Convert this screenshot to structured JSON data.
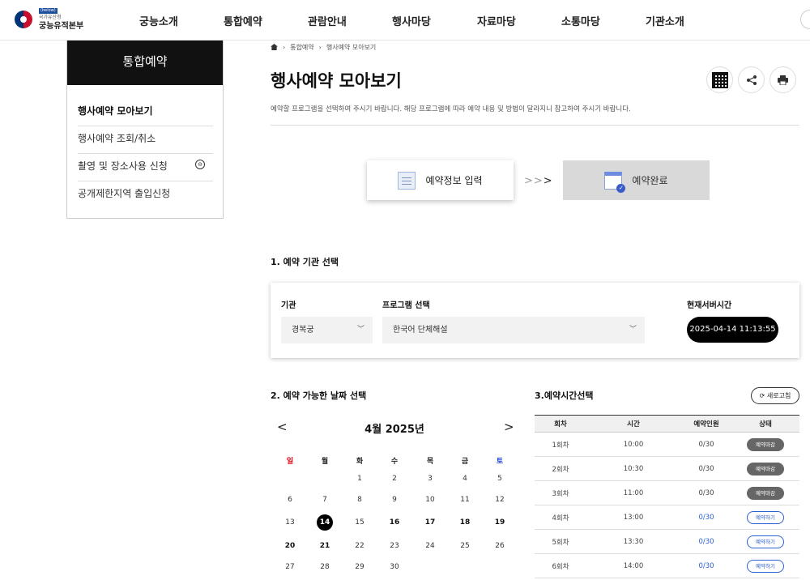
{
  "header": {
    "logo": {
      "tag": "(below)",
      "sub": "국가유산청",
      "name": "궁능유적본부"
    },
    "nav": [
      "궁능소개",
      "통합예약",
      "관람안내",
      "행사마당",
      "자료마당",
      "소통마당",
      "기관소개"
    ]
  },
  "sidebar": {
    "title": "통합예약",
    "items": [
      {
        "label": "행사예약 모아보기",
        "active": true
      },
      {
        "label": "행사예약 조회/취소",
        "active": false
      },
      {
        "label": "촬영 및 장소사용 신청",
        "active": false,
        "toggle": "⊖"
      },
      {
        "label": "공개제한지역 출입신청",
        "active": false
      }
    ]
  },
  "breadcrumb": {
    "level1": "통합예약",
    "level2": "행사예약 모아보기"
  },
  "page": {
    "title": "행사예약 모아보기",
    "description": "예약할 프로그램을 선택하여 주시기 바랍니다. 해당 프로그램에 따라 예약 내용 및 방법이 달라지니 참고하여 주시기 바랍니다."
  },
  "steps": [
    {
      "label": "예약정보 입력",
      "icon": "document-icon",
      "active": true
    },
    {
      "label": "예약완료",
      "icon": "calendar-check-icon",
      "active": false
    }
  ],
  "section1": {
    "title": "1. 예약 기관 선택",
    "org_label": "기관",
    "org_value": "경복궁",
    "program_label": "프로그램 선택",
    "program_value": "한국어 단체해설",
    "server_time_label": "현재서버시간",
    "server_time": "2025-04-14 11:13:55"
  },
  "calendar": {
    "title": "2. 예약 가능한 날짜 선택",
    "month": "4월 2025년",
    "weekdays": [
      "일",
      "월",
      "화",
      "수",
      "목",
      "금",
      "토"
    ],
    "weekday_colors": [
      "#e60012",
      "#222222",
      "#222222",
      "#222222",
      "#222222",
      "#222222",
      "#1a3fd1"
    ],
    "weeks": [
      [
        "",
        "",
        "1",
        "2",
        "3",
        "4",
        "5"
      ],
      [
        "6",
        "7",
        "8",
        "9",
        "10",
        "11",
        "12"
      ],
      [
        "13",
        "14",
        "15",
        "16",
        "17",
        "18",
        "19"
      ],
      [
        "20",
        "21",
        "22",
        "23",
        "24",
        "25",
        "26"
      ],
      [
        "27",
        "28",
        "29",
        "30",
        "",
        "",
        ""
      ]
    ],
    "today": "14",
    "available": [
      "14",
      "16",
      "17",
      "18",
      "19",
      "20",
      "21"
    ]
  },
  "timetable": {
    "title": "3.예약시간선택",
    "refresh_label": "새로고침",
    "columns": [
      "회차",
      "시간",
      "예약인원",
      "상태"
    ],
    "rows": [
      {
        "round": "1회차",
        "time": "10:00",
        "count": "0/30",
        "status": "예약마감",
        "open": false
      },
      {
        "round": "2회차",
        "time": "10:30",
        "count": "0/30",
        "status": "예약마감",
        "open": false
      },
      {
        "round": "3회차",
        "time": "11:00",
        "count": "0/30",
        "status": "예약마감",
        "open": false
      },
      {
        "round": "4회차",
        "time": "13:00",
        "count": "0/30",
        "status": "예약하기",
        "open": true
      },
      {
        "round": "5회차",
        "time": "13:30",
        "count": "0/30",
        "status": "예약하기",
        "open": true
      },
      {
        "round": "6회차",
        "time": "14:00",
        "count": "0/30",
        "status": "예약하기",
        "open": true
      }
    ]
  }
}
